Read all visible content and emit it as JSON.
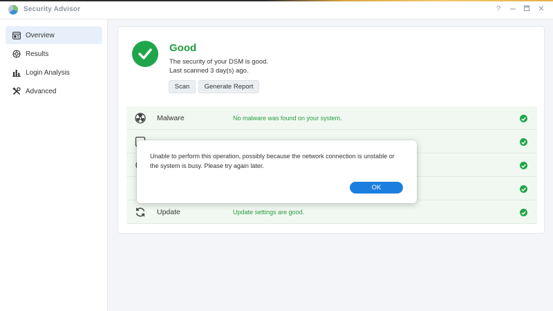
{
  "window": {
    "title": "Security Advisor",
    "controls": {
      "help": "?",
      "minimize": "—",
      "maximize": "▢",
      "close": "✕"
    }
  },
  "sidebar": {
    "items": [
      {
        "label": "Overview",
        "icon": "overview-icon",
        "active": true
      },
      {
        "label": "Results",
        "icon": "results-icon",
        "active": false
      },
      {
        "label": "Login Analysis",
        "icon": "bar-chart-icon",
        "active": false
      },
      {
        "label": "Advanced",
        "icon": "tools-icon",
        "active": false
      }
    ]
  },
  "summary": {
    "status": "Good",
    "description": "The security of your DSM is good.",
    "last_scanned": "Last scanned 3 day(s) ago.",
    "scan_label": "Scan",
    "report_label": "Generate Report"
  },
  "checks": [
    {
      "name": "Malware",
      "status": "No malware was found on your system.",
      "icon": "malware-icon"
    },
    {
      "name": "",
      "status": "",
      "icon": "system-icon"
    },
    {
      "name": "",
      "status": "",
      "icon": "account-icon"
    },
    {
      "name": "",
      "status": "",
      "icon": "network-icon"
    },
    {
      "name": "Update",
      "status": "Update settings are good.",
      "icon": "update-icon"
    }
  ],
  "dialog": {
    "message": "Unable to perform this operation, possibly because the network connection is unstable or the system is busy. Please try again later.",
    "ok_label": "OK"
  },
  "colors": {
    "good_green": "#1fa64a",
    "accent_blue": "#1c7fe0",
    "active_nav_bg": "#e7f0fa"
  }
}
